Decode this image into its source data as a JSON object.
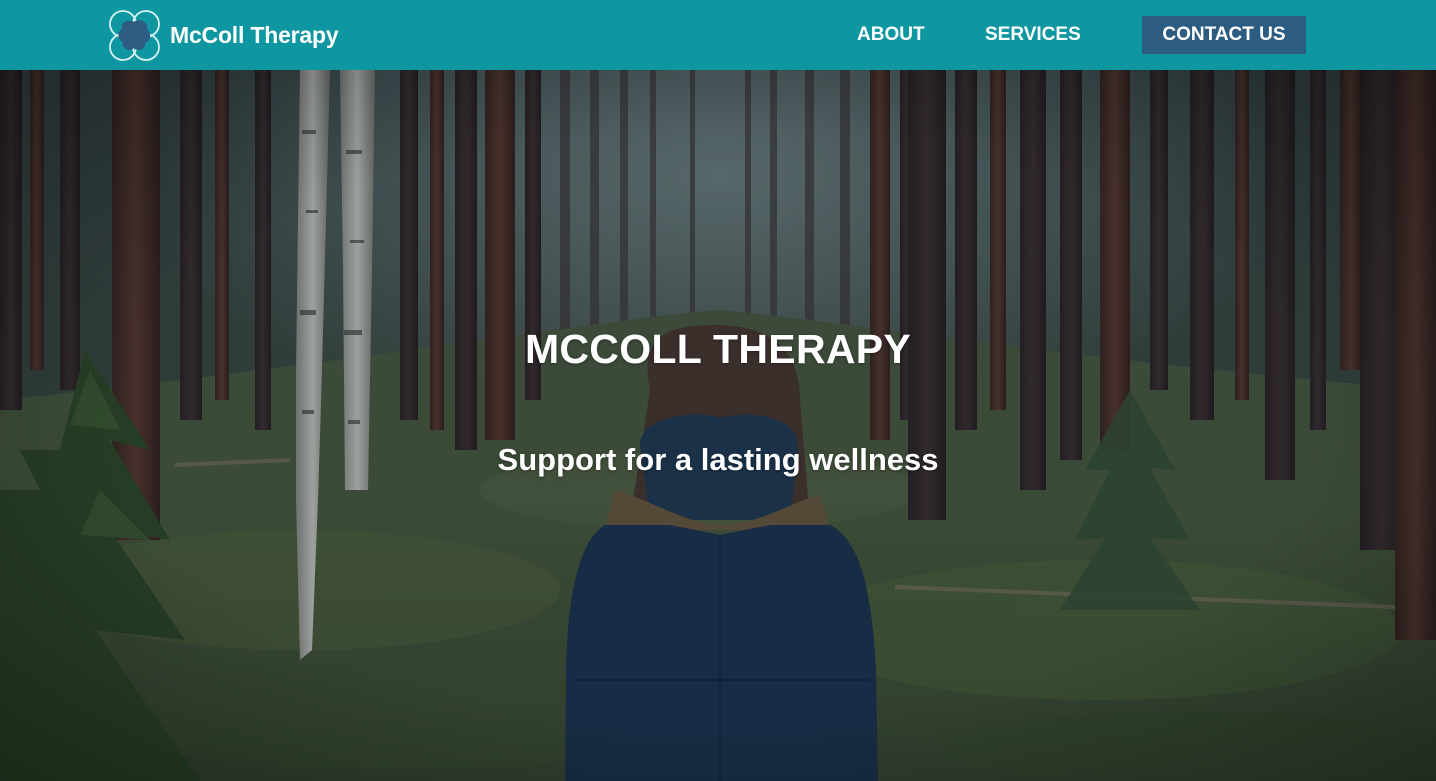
{
  "header": {
    "brand_name": "McColl Therapy",
    "logo_icon": "cloud-flower-logo-icon",
    "nav": {
      "about": "ABOUT",
      "services": "SERVICES",
      "contact": "CONTACT US"
    }
  },
  "hero": {
    "title": "MCCOLL THERAPY",
    "subtitle": "Support for a lasting wellness",
    "background_image": "forest-woman-photo"
  },
  "colors": {
    "header_bg": "#0e97a0",
    "contact_button_bg": "#2d5c83",
    "text": "#ffffff"
  }
}
